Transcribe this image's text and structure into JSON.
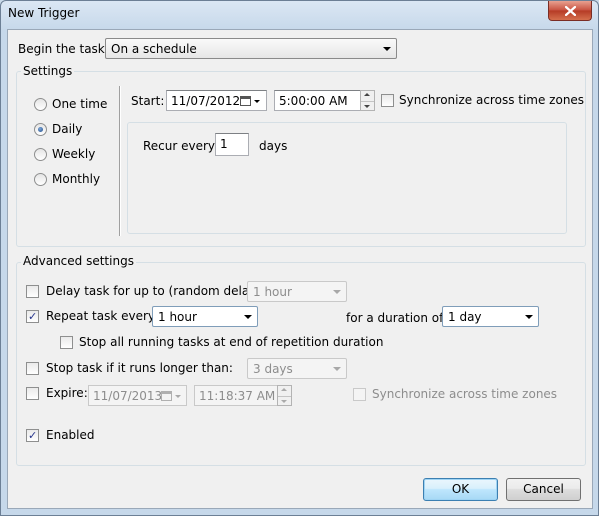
{
  "window": {
    "title": "New Trigger",
    "close_icon": "close-icon"
  },
  "begin": {
    "label": "Begin the task:",
    "value": "On a schedule"
  },
  "settings": {
    "title": "Settings",
    "options": [
      "One time",
      "Daily",
      "Weekly",
      "Monthly"
    ],
    "selected": "Daily",
    "start_label": "Start:",
    "start_date": "11/07/2012",
    "start_time": "5:00:00 AM",
    "sync_label": "Synchronize across time zones",
    "recur_label": "Recur every:",
    "recur_value": "1",
    "recur_unit": "days"
  },
  "advanced": {
    "title": "Advanced settings",
    "delay_label": "Delay task for up to (random delay):",
    "delay_value": "1 hour",
    "repeat_label": "Repeat task every:",
    "repeat_value": "1 hour",
    "duration_label": "for a duration of:",
    "duration_value": "1 day",
    "stop_all_label": "Stop all running tasks at end of repetition duration",
    "stop_longer_label": "Stop task if it runs longer than:",
    "stop_longer_value": "3 days",
    "expire_label": "Expire:",
    "expire_date": "11/07/2013",
    "expire_time": "11:18:37 AM",
    "expire_sync_label": "Synchronize across time zones",
    "enabled_label": "Enabled"
  },
  "buttons": {
    "ok": "OK",
    "cancel": "Cancel"
  },
  "state": {
    "delay_checked": false,
    "repeat_checked": true,
    "stop_all_checked": false,
    "stop_longer_checked": false,
    "expire_checked": false,
    "expire_sync_checked": false,
    "sync_checked": false,
    "enabled_checked": true
  }
}
